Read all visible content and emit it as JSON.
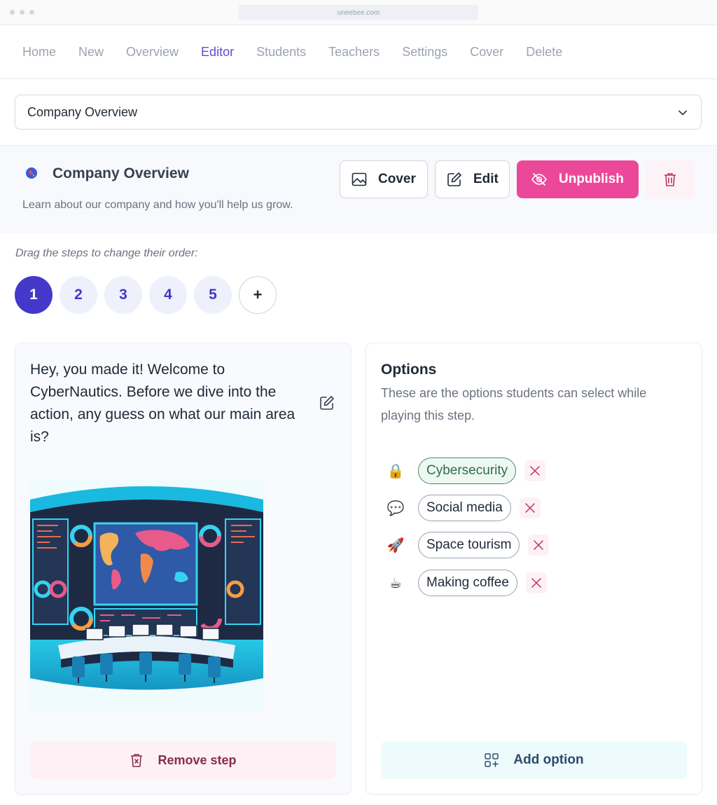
{
  "browser": {
    "url": "uneebee.com"
  },
  "nav": {
    "items": [
      {
        "label": "Home",
        "active": false
      },
      {
        "label": "New",
        "active": false
      },
      {
        "label": "Overview",
        "active": false
      },
      {
        "label": "Editor",
        "active": true
      },
      {
        "label": "Students",
        "active": false
      },
      {
        "label": "Teachers",
        "active": false
      },
      {
        "label": "Settings",
        "active": false
      },
      {
        "label": "Cover",
        "active": false
      },
      {
        "label": "Delete",
        "active": false
      }
    ]
  },
  "lesson_select": {
    "value": "Company Overview"
  },
  "lesson": {
    "title": "Company Overview",
    "subtitle": "Learn about our company and how you'll help us grow.",
    "icon": "globe-emoji-icon"
  },
  "actions": {
    "cover_label": "Cover",
    "edit_label": "Edit",
    "unpublish_label": "Unpublish"
  },
  "steps": {
    "hint": "Drag the steps to change their order:",
    "items": [
      "1",
      "2",
      "3",
      "4",
      "5"
    ],
    "active": "1",
    "add_label": "+"
  },
  "step_content": {
    "question": "Hey, you made it! Welcome to CyberNautics. Before we dive into the action, any guess on what our main area is?",
    "remove_label": "Remove step"
  },
  "options": {
    "title": "Options",
    "description": "These are the options students can select while playing this step.",
    "items": [
      {
        "label": "Cybersecurity",
        "icon": "lock-icon",
        "emoji": "🔒",
        "correct": true
      },
      {
        "label": "Social media",
        "icon": "chat-bubble-icon",
        "emoji": "💬",
        "correct": false
      },
      {
        "label": "Space tourism",
        "icon": "rocket-icon",
        "emoji": "🚀",
        "correct": false
      },
      {
        "label": "Making coffee",
        "icon": "coffee-icon",
        "emoji": "☕",
        "correct": false
      }
    ],
    "add_label": "Add option"
  },
  "colors": {
    "accent": "#5b4bdb",
    "step_active": "#4338ca",
    "unpublish": "#ec4899",
    "correct": "#4a8a6b"
  }
}
